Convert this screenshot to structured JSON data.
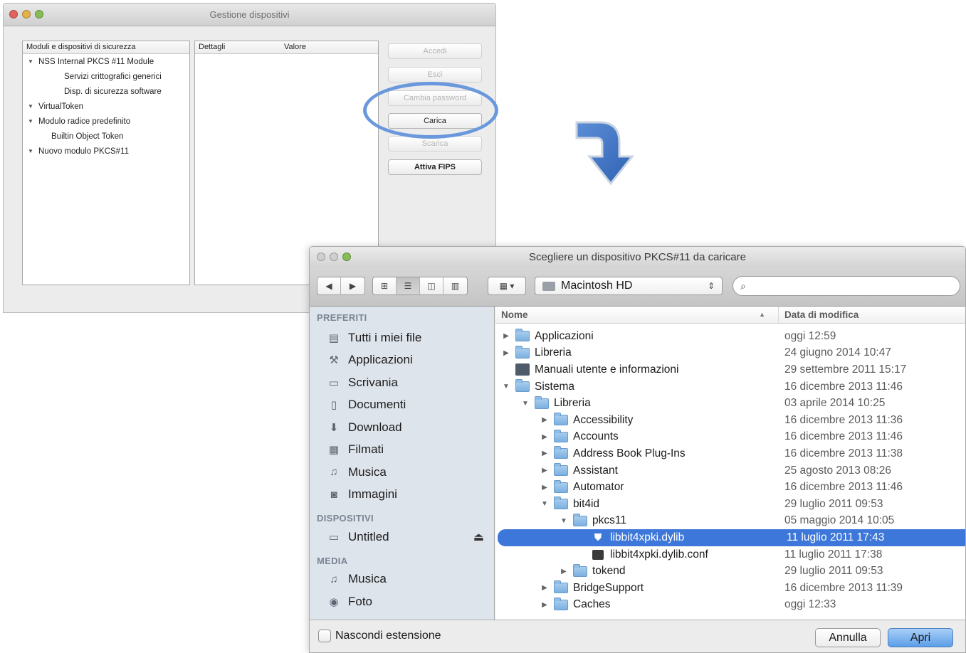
{
  "device_manager": {
    "title": "Gestione dispositivi",
    "tree_header": "Moduli e dispositivi di sicurezza",
    "tree": [
      {
        "label": "NSS Internal PKCS #11 Module",
        "level": 0,
        "expanded": true
      },
      {
        "label": "Servizi crittografici generici",
        "level": 2
      },
      {
        "label": "Disp. di sicurezza software",
        "level": 2
      },
      {
        "label": "VirtualToken",
        "level": 0,
        "expanded": true
      },
      {
        "label": "Modulo radice predefinito",
        "level": 0,
        "expanded": true
      },
      {
        "label": "Builtin Object Token",
        "level": 1
      },
      {
        "label": "Nuovo modulo PKCS#11",
        "level": 0,
        "expanded": true
      }
    ],
    "details_header": "Dettagli",
    "value_header": "Valore",
    "buttons": {
      "login": "Accedi",
      "logout": "Esci",
      "change_password": "Cambia password",
      "load": "Carica",
      "unload": "Scarica",
      "enable_fips": "Attiva FIPS"
    }
  },
  "open_dialog": {
    "title": "Scegliere un dispositivo PKCS#11 da caricare",
    "location": "Macintosh HD",
    "search_placeholder": "",
    "sidebar": {
      "favorites_header": "PREFERITI",
      "favorites": [
        {
          "label": "Tutti i miei file",
          "icon": "all-files-icon"
        },
        {
          "label": "Applicazioni",
          "icon": "applications-icon"
        },
        {
          "label": "Scrivania",
          "icon": "desktop-icon"
        },
        {
          "label": "Documenti",
          "icon": "documents-icon"
        },
        {
          "label": "Download",
          "icon": "download-icon"
        },
        {
          "label": "Filmati",
          "icon": "movies-icon"
        },
        {
          "label": "Musica",
          "icon": "music-icon"
        },
        {
          "label": "Immagini",
          "icon": "pictures-icon"
        }
      ],
      "devices_header": "DISPOSITIVI",
      "devices": [
        {
          "label": "Untitled",
          "icon": "disk-icon"
        }
      ],
      "media_header": "MEDIA",
      "media": [
        {
          "label": "Musica",
          "icon": "music-icon"
        },
        {
          "label": "Foto",
          "icon": "camera-icon"
        }
      ]
    },
    "columns": {
      "name": "Nome",
      "date": "Data di modifica"
    },
    "rows": [
      {
        "name": "Applicazioni",
        "date": "oggi 12:59",
        "level": 0,
        "tri": "▶",
        "kind": "folder"
      },
      {
        "name": "Libreria",
        "date": "24 giugno 2014 10:47",
        "level": 0,
        "tri": "▶",
        "kind": "folder"
      },
      {
        "name": "Manuali utente e informazioni",
        "date": "29 settembre 2011 15:17",
        "level": 0,
        "tri": "",
        "kind": "alias"
      },
      {
        "name": "Sistema",
        "date": "16 dicembre 2013 11:46",
        "level": 0,
        "tri": "▼",
        "kind": "folder"
      },
      {
        "name": "Libreria",
        "date": "03 aprile 2014 10:25",
        "level": 1,
        "tri": "▼",
        "kind": "folder"
      },
      {
        "name": "Accessibility",
        "date": "16 dicembre 2013 11:36",
        "level": 2,
        "tri": "▶",
        "kind": "folder"
      },
      {
        "name": "Accounts",
        "date": "16 dicembre 2013 11:46",
        "level": 2,
        "tri": "▶",
        "kind": "folder"
      },
      {
        "name": "Address Book Plug-Ins",
        "date": "16 dicembre 2013 11:38",
        "level": 2,
        "tri": "▶",
        "kind": "folder"
      },
      {
        "name": "Assistant",
        "date": "25 agosto 2013 08:26",
        "level": 2,
        "tri": "▶",
        "kind": "folder"
      },
      {
        "name": "Automator",
        "date": "16 dicembre 2013 11:46",
        "level": 2,
        "tri": "▶",
        "kind": "folder"
      },
      {
        "name": "bit4id",
        "date": "29 luglio 2011 09:53",
        "level": 2,
        "tri": "▼",
        "kind": "folder"
      },
      {
        "name": "pkcs11",
        "date": "05 maggio 2014 10:05",
        "level": 3,
        "tri": "▼",
        "kind": "folder"
      },
      {
        "name": "libbit4xpki.dylib",
        "date": "11 luglio 2011 17:43",
        "level": 4,
        "tri": "",
        "kind": "lib",
        "selected": true
      },
      {
        "name": "libbit4xpki.dylib.conf",
        "date": "11 luglio 2011 17:38",
        "level": 4,
        "tri": "",
        "kind": "file"
      },
      {
        "name": "tokend",
        "date": "29 luglio 2011 09:53",
        "level": 3,
        "tri": "▶",
        "kind": "folder"
      },
      {
        "name": "BridgeSupport",
        "date": "16 dicembre 2013 11:39",
        "level": 2,
        "tri": "▶",
        "kind": "folder"
      },
      {
        "name": "Caches",
        "date": "oggi 12:33",
        "level": 2,
        "tri": "▶",
        "kind": "folder"
      }
    ],
    "hide_extension_label": "Nascondi estensione",
    "cancel": "Annulla",
    "open": "Apri"
  },
  "colors": {
    "highlight_ring": "#6a98dc",
    "selection": "#3d77d9",
    "sidebar_bg": "#dee4ec"
  }
}
